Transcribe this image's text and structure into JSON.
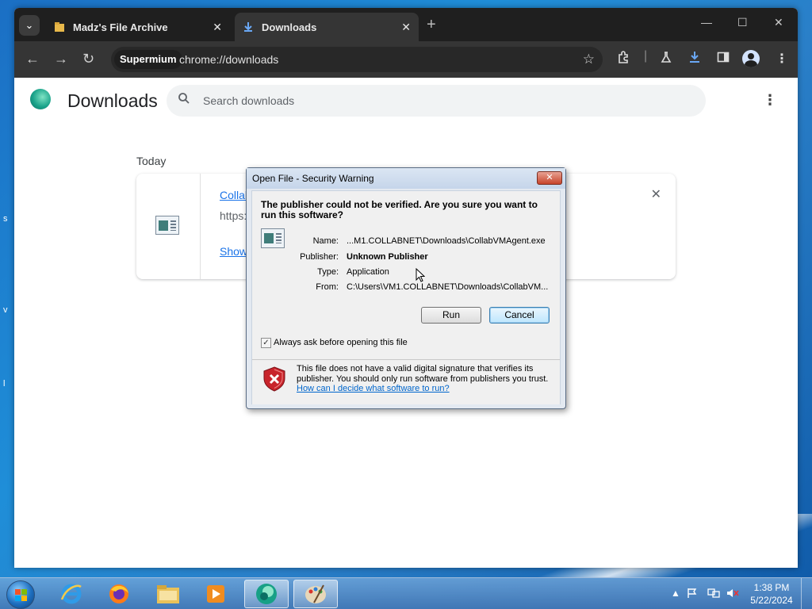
{
  "browser": {
    "tabs": [
      {
        "title": "Madz's File Archive",
        "icon": "folder-icon"
      },
      {
        "title": "Downloads",
        "icon": "download-icon"
      }
    ],
    "site_chip": "Supermium",
    "url": "chrome://downloads"
  },
  "page": {
    "title": "Downloads",
    "search_placeholder": "Search downloads",
    "section": "Today",
    "download": {
      "name": "Collab",
      "url": "https:",
      "action": "Show"
    }
  },
  "dialog": {
    "title": "Open File - Security Warning",
    "question": "The publisher could not be verified.  Are you sure you want to run this software?",
    "fields": [
      {
        "label": "Name:",
        "value": "...M1.COLLABNET\\Downloads\\CollabVMAgent.exe",
        "bold": false
      },
      {
        "label": "Publisher:",
        "value": "Unknown Publisher",
        "bold": true
      },
      {
        "label": "Type:",
        "value": "Application",
        "bold": false
      },
      {
        "label": "From:",
        "value": "C:\\Users\\VM1.COLLABNET\\Downloads\\CollabVM...",
        "bold": false
      }
    ],
    "run_label": "Run",
    "cancel_label": "Cancel",
    "checkbox_label": "Always ask before opening this file",
    "checkbox_checked": true,
    "warning_text": "This file does not have a valid digital signature that verifies its publisher.  You should only run software from publishers you trust.",
    "warning_link": "How can I decide what software to run?"
  },
  "taskbar": {
    "apps": [
      "internet-explorer-icon",
      "firefox-icon",
      "file-explorer-icon",
      "media-player-icon",
      "supermium-icon",
      "paint-icon"
    ],
    "time": "1:38 PM",
    "date": "5/22/2024"
  }
}
